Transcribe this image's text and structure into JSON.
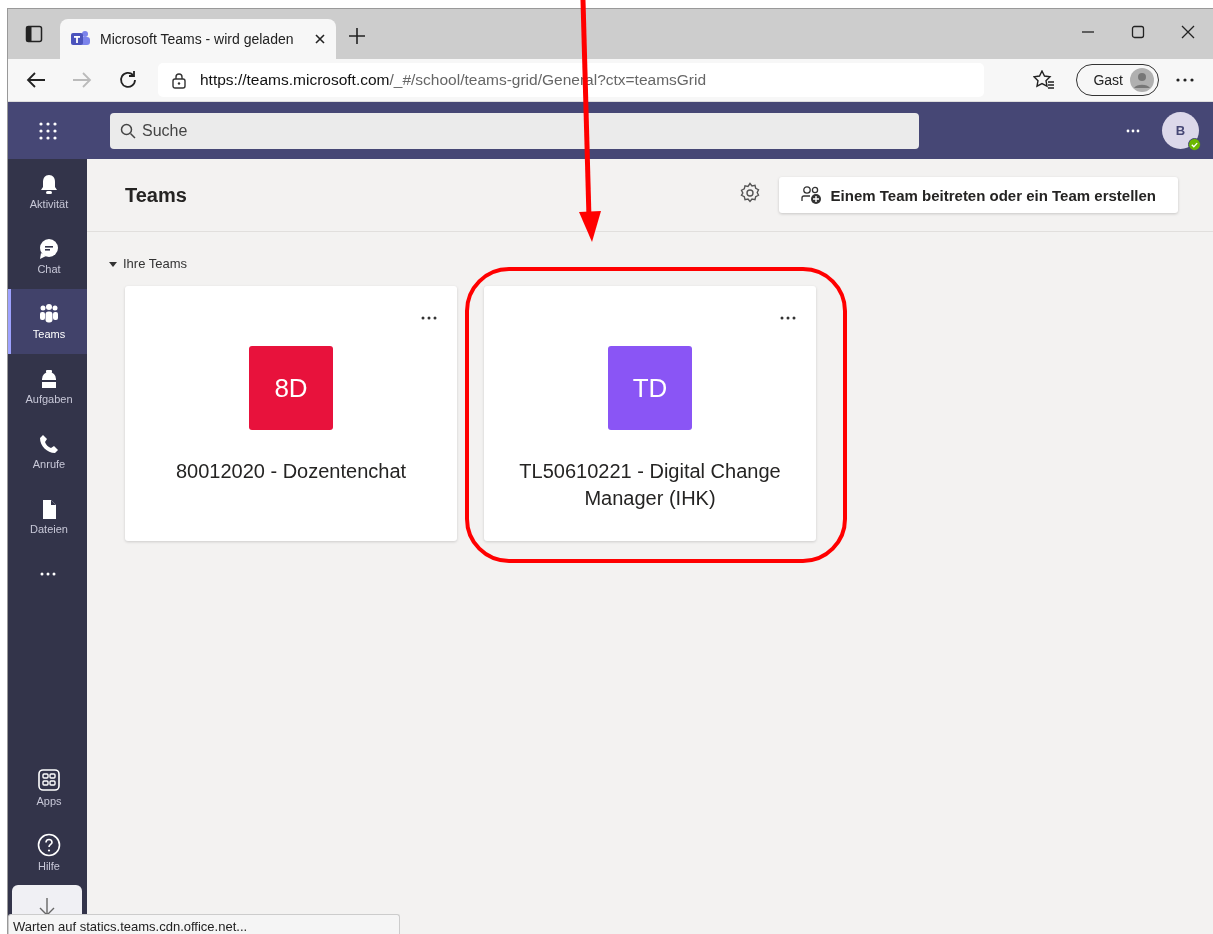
{
  "browser": {
    "tab_title": "Microsoft Teams - wird geladen",
    "url_host": "https://teams.microsoft.com",
    "url_path": "/_#/school/teams-grid/General?ctx=teamsGrid",
    "profile": "Gast"
  },
  "topbar": {
    "search_placeholder": "Suche",
    "avatar": "B"
  },
  "rail": [
    {
      "label": "Aktivität",
      "selected": false
    },
    {
      "label": "Chat",
      "selected": false
    },
    {
      "label": "Teams",
      "selected": true
    },
    {
      "label": "Aufgaben",
      "selected": false
    },
    {
      "label": "Anrufe",
      "selected": false
    },
    {
      "label": "Dateien",
      "selected": false
    }
  ],
  "rail_bottom": [
    {
      "label": "Apps"
    },
    {
      "label": "Hilfe"
    }
  ],
  "header": {
    "title": "Teams",
    "join_button": "Einem Team beitreten oder ein Team erstellen"
  },
  "section": {
    "label": "Ihre Teams",
    "expanded": true
  },
  "teams": [
    {
      "initials": "8D",
      "name": "80012020 - Dozentenchat",
      "color": "#e8123c"
    },
    {
      "initials": "TD",
      "name": "TL50610221 - Digital Change Manager (IHK)",
      "color": "#8a55f5"
    }
  ],
  "status_bar": "Warten auf statics.teams.cdn.office.net..."
}
